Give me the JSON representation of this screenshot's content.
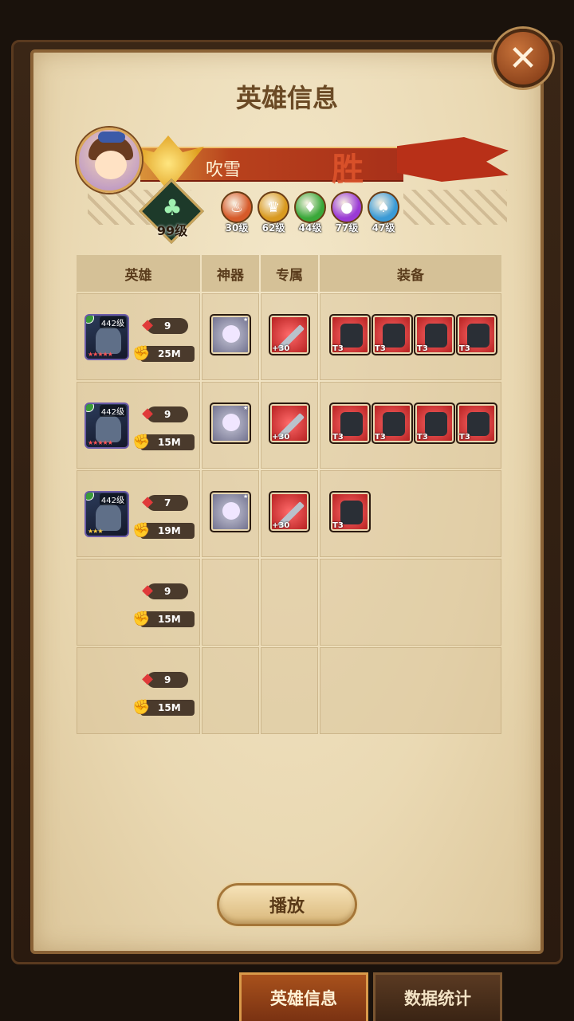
{
  "header": {
    "title": "英雄信息"
  },
  "player": {
    "name": "吹雪",
    "result_mark": "胜",
    "level": "99级",
    "factions": [
      {
        "level": "30级",
        "color": "#d65a2a",
        "icon": "flame-icon"
      },
      {
        "level": "62级",
        "color": "#d99a20",
        "icon": "crown-icon"
      },
      {
        "level": "44级",
        "color": "#3aa83a",
        "icon": "leaf-icon"
      },
      {
        "level": "77级",
        "color": "#9a3ad6",
        "icon": "orb-icon"
      },
      {
        "level": "47级",
        "color": "#3a9ad6",
        "icon": "crystal-icon"
      }
    ]
  },
  "table": {
    "headers": {
      "hero": "英雄",
      "artifact": "神器",
      "exclusive": "专属",
      "equipment": "装备"
    },
    "rows": [
      {
        "hero_level": "442级",
        "stars": "★★★★★",
        "gems": "9",
        "power": "25M",
        "has_hero": true,
        "exclusive_tag": "+30",
        "equipment_tags": [
          "T3",
          "T3",
          "T3",
          "T3"
        ]
      },
      {
        "hero_level": "442级",
        "stars": "★★★★★",
        "gems": "9",
        "power": "15M",
        "has_hero": true,
        "exclusive_tag": "+30",
        "equipment_tags": [
          "T3",
          "T3",
          "T3",
          "T3"
        ]
      },
      {
        "hero_level": "442级",
        "stars": "★★★",
        "gems": "7",
        "power": "19M",
        "has_hero": true,
        "exclusive_tag": "+30",
        "equipment_tags": [
          "T3"
        ]
      },
      {
        "gems": "9",
        "power": "15M",
        "has_hero": false
      },
      {
        "gems": "9",
        "power": "15M",
        "has_hero": false
      }
    ]
  },
  "buttons": {
    "play": "播放",
    "close": "✕"
  },
  "tabs": [
    {
      "label": "英雄信息",
      "active": true
    },
    {
      "label": "数据统计",
      "active": false
    }
  ]
}
